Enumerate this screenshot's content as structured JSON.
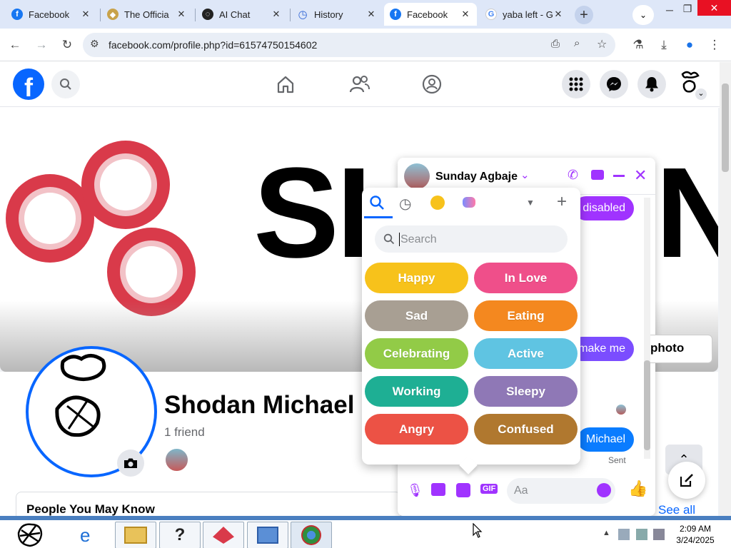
{
  "browser": {
    "tabs": [
      {
        "title": "Facebook",
        "active": false
      },
      {
        "title": "The Officia",
        "active": false
      },
      {
        "title": "AI Chat",
        "active": false
      },
      {
        "title": "History",
        "active": false
      },
      {
        "title": "Facebook",
        "active": true
      },
      {
        "title": "yaba left - G",
        "active": false
      }
    ],
    "url": "facebook.com/profile.php?id=61574750154602"
  },
  "cover": {
    "text": "SH",
    "text_end": "N"
  },
  "profile": {
    "name": "Shodan Michael",
    "friends": "1 friend",
    "people_you_may_know": "People You May Know",
    "see_all": "See all"
  },
  "chat": {
    "contact": "Sunday Agbaje",
    "messages": [
      {
        "text": "disabled",
        "color": "#a033ff"
      },
      {
        "text": "make me",
        "color": "#7b4dff"
      },
      {
        "text": "Michael",
        "color": "#0a7cff"
      }
    ],
    "photo_button": "photo",
    "sent_label": "Sent",
    "composer_placeholder": "Aa"
  },
  "sticker_picker": {
    "search_placeholder": "Search",
    "moods": [
      {
        "label": "Happy",
        "color": "#f7c21b"
      },
      {
        "label": "In Love",
        "color": "#ef4f8a"
      },
      {
        "label": "Sad",
        "color": "#a89f93"
      },
      {
        "label": "Eating",
        "color": "#f4881f"
      },
      {
        "label": "Celebrating",
        "color": "#92cb47"
      },
      {
        "label": "Active",
        "color": "#5fc4e2"
      },
      {
        "label": "Working",
        "color": "#1eaf94"
      },
      {
        "label": "Sleepy",
        "color": "#8f78b6"
      },
      {
        "label": "Angry",
        "color": "#ec5245"
      },
      {
        "label": "Confused",
        "color": "#b0782f"
      }
    ]
  },
  "taskbar": {
    "time": "2:09 AM",
    "date": "3/24/2025"
  },
  "colors": {
    "fb_blue": "#0866ff",
    "messenger_purple": "#a033ff"
  }
}
